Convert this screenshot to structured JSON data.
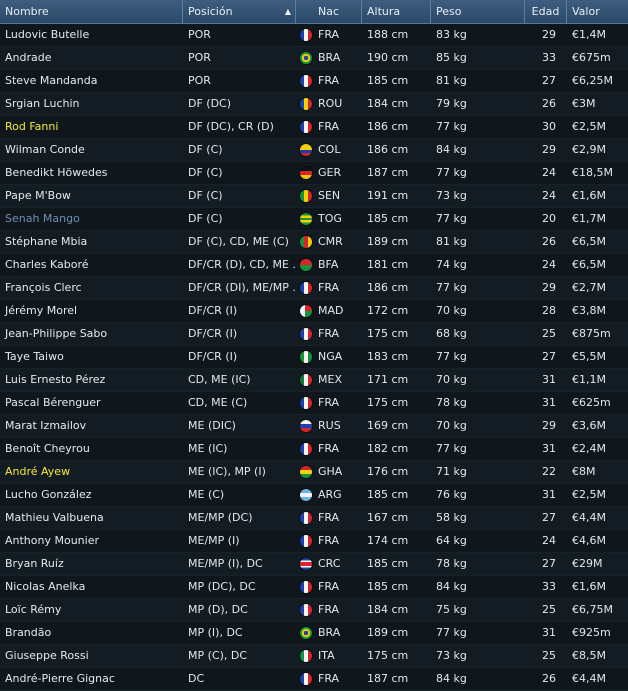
{
  "columns": {
    "name": "Nombre",
    "position": "Posición",
    "sort_indicator": "▲",
    "nation": "Nac",
    "height": "Altura",
    "weight": "Peso",
    "age": "Edad",
    "value": "Valor"
  },
  "rows": [
    {
      "name": "Ludovic Butelle",
      "position": "POR",
      "nation": "FRA",
      "height": "188 cm",
      "weight": "83 kg",
      "age": "29",
      "value": "€1,4M"
    },
    {
      "name": "Andrade",
      "position": "POR",
      "nation": "BRA",
      "height": "190 cm",
      "weight": "85 kg",
      "age": "33",
      "value": "€675m"
    },
    {
      "name": "Steve Mandanda",
      "position": "POR",
      "nation": "FRA",
      "height": "185 cm",
      "weight": "81 kg",
      "age": "27",
      "value": "€6,25M"
    },
    {
      "name": "Srgian Luchin",
      "position": "DF (DC)",
      "nation": "ROU",
      "height": "184 cm",
      "weight": "79 kg",
      "age": "26",
      "value": "€3M"
    },
    {
      "name": "Rod Fanni",
      "position": "DF (DC), CR (D)",
      "nation": "FRA",
      "height": "186 cm",
      "weight": "77 kg",
      "age": "30",
      "value": "€2,5M",
      "highlight": "yellow"
    },
    {
      "name": "Wilman Conde",
      "position": "DF (C)",
      "nation": "COL",
      "height": "186 cm",
      "weight": "84 kg",
      "age": "29",
      "value": "€2,9M"
    },
    {
      "name": "Benedikt Höwedes",
      "position": "DF (C)",
      "nation": "GER",
      "height": "187 cm",
      "weight": "77 kg",
      "age": "24",
      "value": "€18,5M"
    },
    {
      "name": "Pape M'Bow",
      "position": "DF (C)",
      "nation": "SEN",
      "height": "191 cm",
      "weight": "73 kg",
      "age": "24",
      "value": "€1,6M"
    },
    {
      "name": "Senah Mango",
      "position": "DF (C)",
      "nation": "TOG",
      "height": "185 cm",
      "weight": "77 kg",
      "age": "20",
      "value": "€1,7M",
      "highlight": "blue"
    },
    {
      "name": "Stéphane Mbia",
      "position": "DF (C), CD, ME (C)",
      "nation": "CMR",
      "height": "189 cm",
      "weight": "81 kg",
      "age": "26",
      "value": "€6,5M"
    },
    {
      "name": "Charles Kaboré",
      "position": "DF/CR (D), CD, ME ..",
      "nation": "BFA",
      "height": "181 cm",
      "weight": "74 kg",
      "age": "24",
      "value": "€6,5M"
    },
    {
      "name": "François Clerc",
      "position": "DF/CR (DI), ME/MP ..",
      "nation": "FRA",
      "height": "186 cm",
      "weight": "77 kg",
      "age": "29",
      "value": "€2,7M"
    },
    {
      "name": "Jérémy Morel",
      "position": "DF/CR (I)",
      "nation": "MAD",
      "height": "172 cm",
      "weight": "70 kg",
      "age": "28",
      "value": "€3,8M"
    },
    {
      "name": "Jean-Philippe Sabo",
      "position": "DF/CR (I)",
      "nation": "FRA",
      "height": "175 cm",
      "weight": "68 kg",
      "age": "25",
      "value": "€875m"
    },
    {
      "name": "Taye Taiwo",
      "position": "DF/CR (I)",
      "nation": "NGA",
      "height": "183 cm",
      "weight": "77 kg",
      "age": "27",
      "value": "€5,5M"
    },
    {
      "name": "Luis Ernesto Pérez",
      "position": "CD, ME (IC)",
      "nation": "MEX",
      "height": "171 cm",
      "weight": "70 kg",
      "age": "31",
      "value": "€1,1M"
    },
    {
      "name": "Pascal Bérenguer",
      "position": "CD, ME (C)",
      "nation": "FRA",
      "height": "175 cm",
      "weight": "78 kg",
      "age": "31",
      "value": "€625m"
    },
    {
      "name": "Marat Izmailov",
      "position": "ME (DIC)",
      "nation": "RUS",
      "height": "169 cm",
      "weight": "70 kg",
      "age": "29",
      "value": "€3,6M"
    },
    {
      "name": "Benoît Cheyrou",
      "position": "ME (IC)",
      "nation": "FRA",
      "height": "182 cm",
      "weight": "77 kg",
      "age": "31",
      "value": "€2,4M"
    },
    {
      "name": "André Ayew",
      "position": "ME (IC), MP (I)",
      "nation": "GHA",
      "height": "176 cm",
      "weight": "71 kg",
      "age": "22",
      "value": "€8M",
      "highlight": "yellow"
    },
    {
      "name": "Lucho González",
      "position": "ME (C)",
      "nation": "ARG",
      "height": "185 cm",
      "weight": "76 kg",
      "age": "31",
      "value": "€2,5M"
    },
    {
      "name": "Mathieu Valbuena",
      "position": "ME/MP (DC)",
      "nation": "FRA",
      "height": "167 cm",
      "weight": "58 kg",
      "age": "27",
      "value": "€4,4M"
    },
    {
      "name": "Anthony Mounier",
      "position": "ME/MP (I)",
      "nation": "FRA",
      "height": "174 cm",
      "weight": "64 kg",
      "age": "24",
      "value": "€4,6M"
    },
    {
      "name": "Bryan Ruíz",
      "position": "ME/MP (I), DC",
      "nation": "CRC",
      "height": "185 cm",
      "weight": "78 kg",
      "age": "27",
      "value": "€29M"
    },
    {
      "name": "Nicolas Anelka",
      "position": "MP (DC), DC",
      "nation": "FRA",
      "height": "185 cm",
      "weight": "84 kg",
      "age": "33",
      "value": "€1,6M"
    },
    {
      "name": "Loïc Rémy",
      "position": "MP (D), DC",
      "nation": "FRA",
      "height": "184 cm",
      "weight": "75 kg",
      "age": "25",
      "value": "€6,75M"
    },
    {
      "name": "Brandão",
      "position": "MP (I), DC",
      "nation": "BRA",
      "height": "189 cm",
      "weight": "77 kg",
      "age": "31",
      "value": "€925m"
    },
    {
      "name": "Giuseppe Rossi",
      "position": "MP (C), DC",
      "nation": "ITA",
      "height": "175 cm",
      "weight": "73 kg",
      "age": "25",
      "value": "€8,5M"
    },
    {
      "name": "André-Pierre Gignac",
      "position": "DC",
      "nation": "FRA",
      "height": "187 cm",
      "weight": "84 kg",
      "age": "26",
      "value": "€4,4M"
    }
  ]
}
